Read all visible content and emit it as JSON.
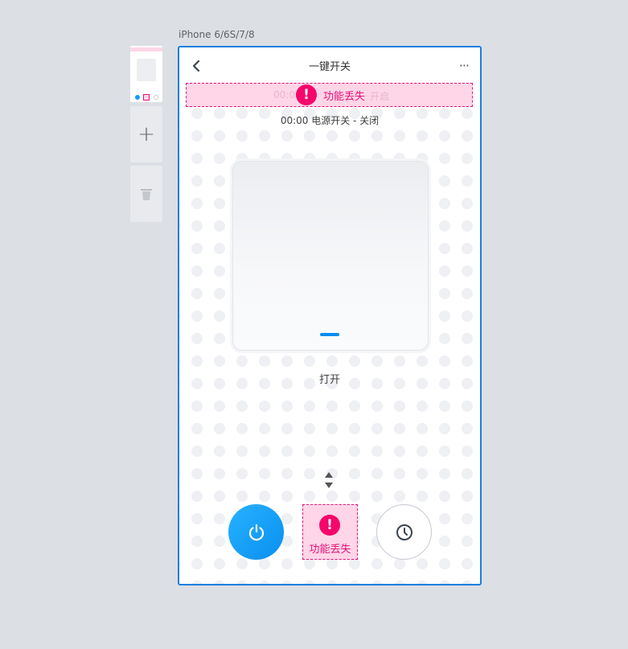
{
  "device": {
    "label": "iPhone 6/6S/7/8"
  },
  "sidebar": {
    "add_label": "+"
  },
  "header": {
    "title": "一键开关",
    "more_label": "···"
  },
  "missing_banner": {
    "faded_left": "00:00",
    "faded_right": "开启",
    "warning_symbol": "!",
    "warning_text": "功能丢失"
  },
  "schedule": {
    "text": "00:00 电源开关 - 关闭"
  },
  "switch": {
    "state_label": "打开"
  },
  "controls": {
    "missing_warning_symbol": "!",
    "missing_warning_text": "功能丢失"
  },
  "colors": {
    "accent": "#0a8ff0",
    "frame": "#1b7fe0",
    "warning": "#f5066a",
    "warning_bg": "#ffd6e7"
  }
}
